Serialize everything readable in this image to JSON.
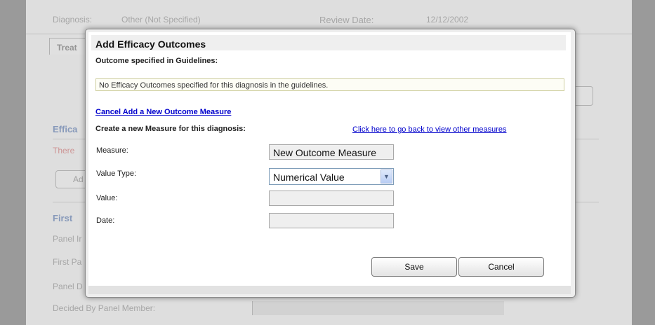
{
  "background": {
    "diagnosis_label": "Diagnosis:",
    "diagnosis_value": "Other (Not Specified)",
    "review_date_label": "Review Date:",
    "review_date_value": "12/12/2002",
    "tab_label": "Treat",
    "efficacy_heading": "Effica",
    "efficacy_warning": "There",
    "add_button_partial": "Ad",
    "first_heading": "First",
    "panel_in_label": "Panel Ir",
    "first_pa_label": "First Pa",
    "panel_d_label": "Panel D",
    "decided_by_label": "Decided By Panel Member:"
  },
  "modal": {
    "title": "Add Efficacy Outcomes",
    "guidelines_heading": "Outcome specified in Guidelines:",
    "guidelines_message": "No Efficacy Outcomes specified for this diagnosis in the guidelines.",
    "cancel_add_link": "Cancel Add a New Outcome Measure",
    "create_heading": "Create a new Measure for this diagnosis:",
    "back_link": "Click here to go back to view other measures",
    "fields": {
      "measure_label": "Measure:",
      "measure_value": "New Outcome Measure",
      "value_type_label": "Value Type:",
      "value_type_selected": "Numerical Value",
      "value_label": "Value:",
      "value_value": "",
      "date_label": "Date:",
      "date_value": ""
    },
    "save_label": "Save",
    "cancel_label": "Cancel"
  },
  "colors": {
    "link": "#0000cc",
    "warning": "#cc3333",
    "heading_blue": "#5577bb"
  }
}
